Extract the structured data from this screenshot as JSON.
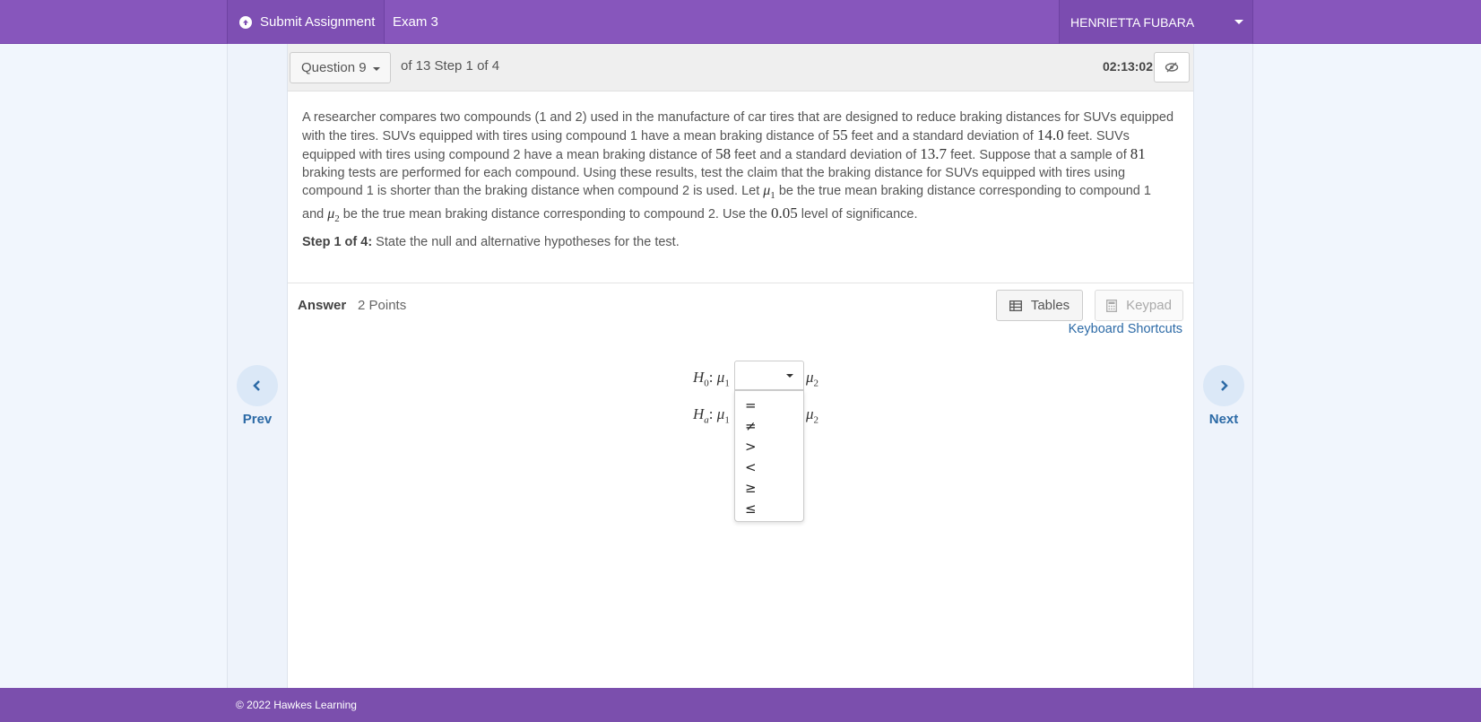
{
  "header": {
    "submit_label": "Submit Assignment",
    "submit_icon": "arrow-up-circle-icon",
    "exam_title": "Exam 3",
    "user_name": "HENRIETTA FUBARA"
  },
  "question_bar": {
    "question_select": "Question 9",
    "of_text": "of 13 Step 1 of 4",
    "timer": "02:13:02"
  },
  "problem": {
    "seg1": "A researcher compares two compounds (1 and 2) used in the manufacture of car tires that are designed to reduce braking distances for SUVs equipped with the tires. SUVs equipped with tires using compound 1 have a mean braking distance of ",
    "n1": "55",
    "seg2": " feet and a standard deviation of ",
    "n2": "14.0",
    "seg3": " feet. SUVs equipped with tires using compound 2 have a mean braking distance of ",
    "n3": "58",
    "seg4": " feet and a standard deviation of ",
    "n4": "13.7",
    "seg5": " feet. Suppose that a sample of ",
    "n5": "81",
    "seg6": " braking tests are performed for each compound. Using these results, test the claim that the braking distance for SUVs equipped with tires using compound 1 is shorter than the braking distance when compound 2 is used. Let ",
    "mu": "μ",
    "sub1": "1",
    "seg7": " be the true mean braking distance corresponding to compound 1 and ",
    "sub2": "2",
    "seg8": " be the true mean braking distance corresponding to compound 2. Use the ",
    "n6": "0.05",
    "seg9": " level of significance.",
    "step_label": "Step 1 of 4:",
    "step_text": " State the null and alternative hypotheses for the test."
  },
  "answer": {
    "label": "Answer",
    "points": "2 Points",
    "tables_label": "Tables",
    "keypad_label": "Keypad",
    "shortcuts_label": "Keyboard Shortcuts"
  },
  "hypotheses": {
    "h_letter": "H",
    "h0_sub": "0",
    "ha_sub": "a",
    "colon": ":",
    "mu": "μ",
    "sub1": "1",
    "sub2": "2",
    "options": [
      "=",
      "≠",
      ">",
      "<",
      "≥",
      "≤"
    ]
  },
  "nav": {
    "prev": "Prev",
    "next": "Next"
  },
  "footer": {
    "copyright": "© 2022 Hawkes Learning"
  },
  "colors": {
    "header_purple": "#8756bc",
    "footer_purple": "#7b4fad",
    "link_blue": "#2c6aa6"
  }
}
